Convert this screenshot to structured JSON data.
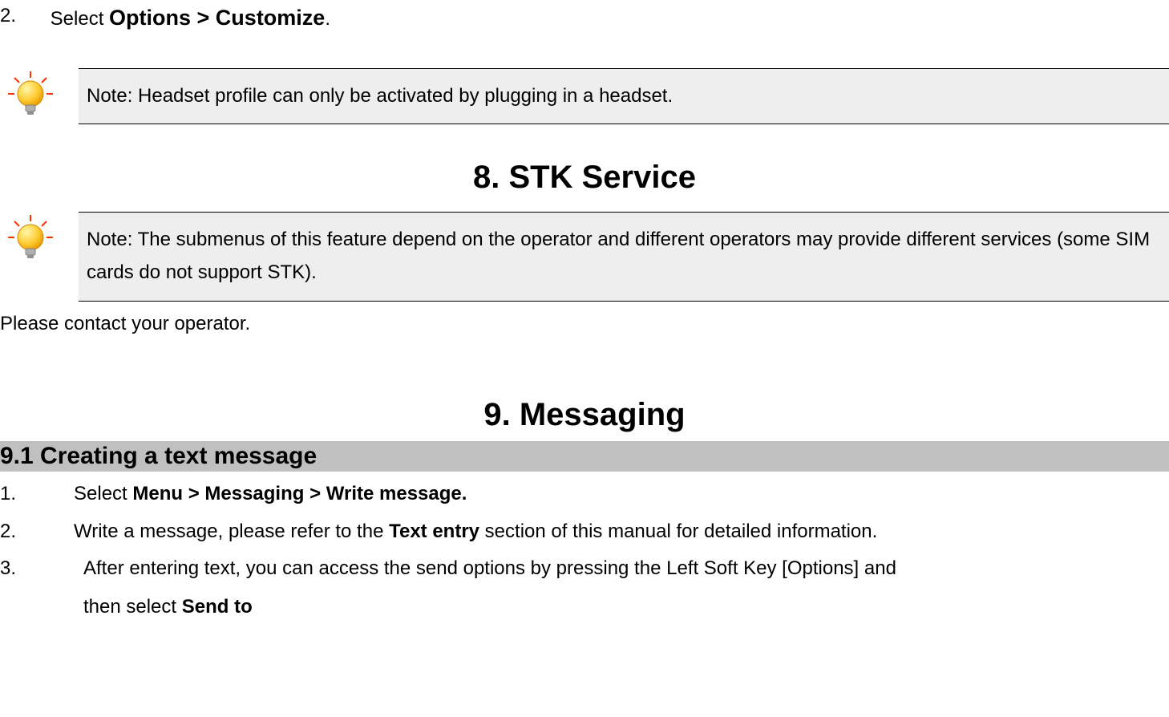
{
  "step2": {
    "number": "2.",
    "prefix": "Select ",
    "bold": "Options > Customize",
    "suffix": "."
  },
  "note1": {
    "text": "Note: Headset profile can only be activated by plugging in a headset."
  },
  "chapter8": {
    "title": "8.   STK Service"
  },
  "note2": {
    "text": "Note: The submenus of this feature depend on the operator and different operators may provide different services (some SIM cards do not support STK)."
  },
  "afterNote2": {
    "text": "Please contact your operator."
  },
  "chapter9": {
    "title": "9.   Messaging"
  },
  "section9_1": {
    "title": "9.1  Creating a text message"
  },
  "steps9_1": [
    {
      "num": "1.",
      "parts": [
        {
          "t": "Select ",
          "b": false
        },
        {
          "t": "Menu > Messaging > Write message.",
          "b": true
        }
      ]
    },
    {
      "num": "2.",
      "parts": [
        {
          "t": "Write a message, please refer to the ",
          "b": false
        },
        {
          "t": "Text entry",
          "b": true
        },
        {
          "t": " section of this manual for detailed information.",
          "b": false
        }
      ]
    },
    {
      "num": "3.",
      "parts": [
        {
          "t": "After entering text, you can access the send options by pressing the Left Soft Key [Options] and",
          "b": false
        }
      ],
      "cont": [
        {
          "t": "then select ",
          "b": false
        },
        {
          "t": "Send to",
          "b": true
        }
      ]
    }
  ],
  "icons": {
    "bulb": "bulb-icon"
  }
}
